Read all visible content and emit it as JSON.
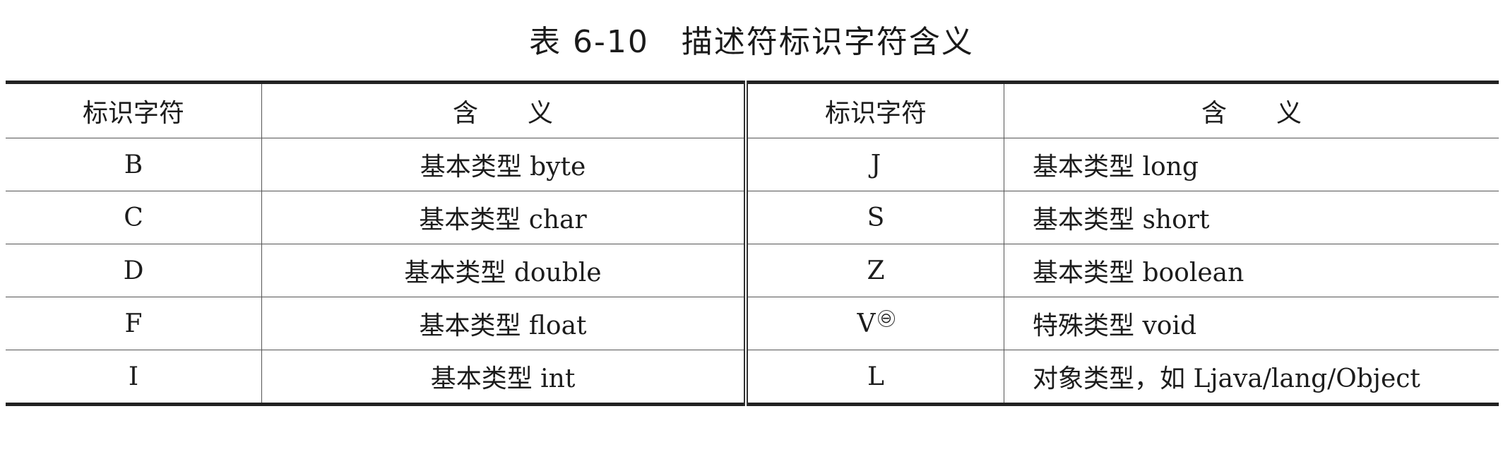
{
  "caption": {
    "number": "表 6-10",
    "title": "描述符标识字符含义"
  },
  "table": {
    "headers": [
      "标识字符",
      "含义",
      "标识字符",
      "含义"
    ],
    "rows": [
      {
        "left_char": "B",
        "left_meaning": "基本类型 byte",
        "right_char": "J",
        "right_meaning": "基本类型 long"
      },
      {
        "left_char": "C",
        "left_meaning": "基本类型 char",
        "right_char": "S",
        "right_meaning": "基本类型 short"
      },
      {
        "left_char": "D",
        "left_meaning": "基本类型 double",
        "right_char": "Z",
        "right_meaning": "基本类型 boolean"
      },
      {
        "left_char": "F",
        "left_meaning": "基本类型 float",
        "right_char": "V",
        "right_note": "⊖",
        "right_meaning": "特殊类型 void"
      },
      {
        "left_char": "I",
        "left_meaning": "基本类型 int",
        "right_char": "L",
        "right_meaning": "对象类型，如 Ljava/lang/Object"
      }
    ]
  }
}
